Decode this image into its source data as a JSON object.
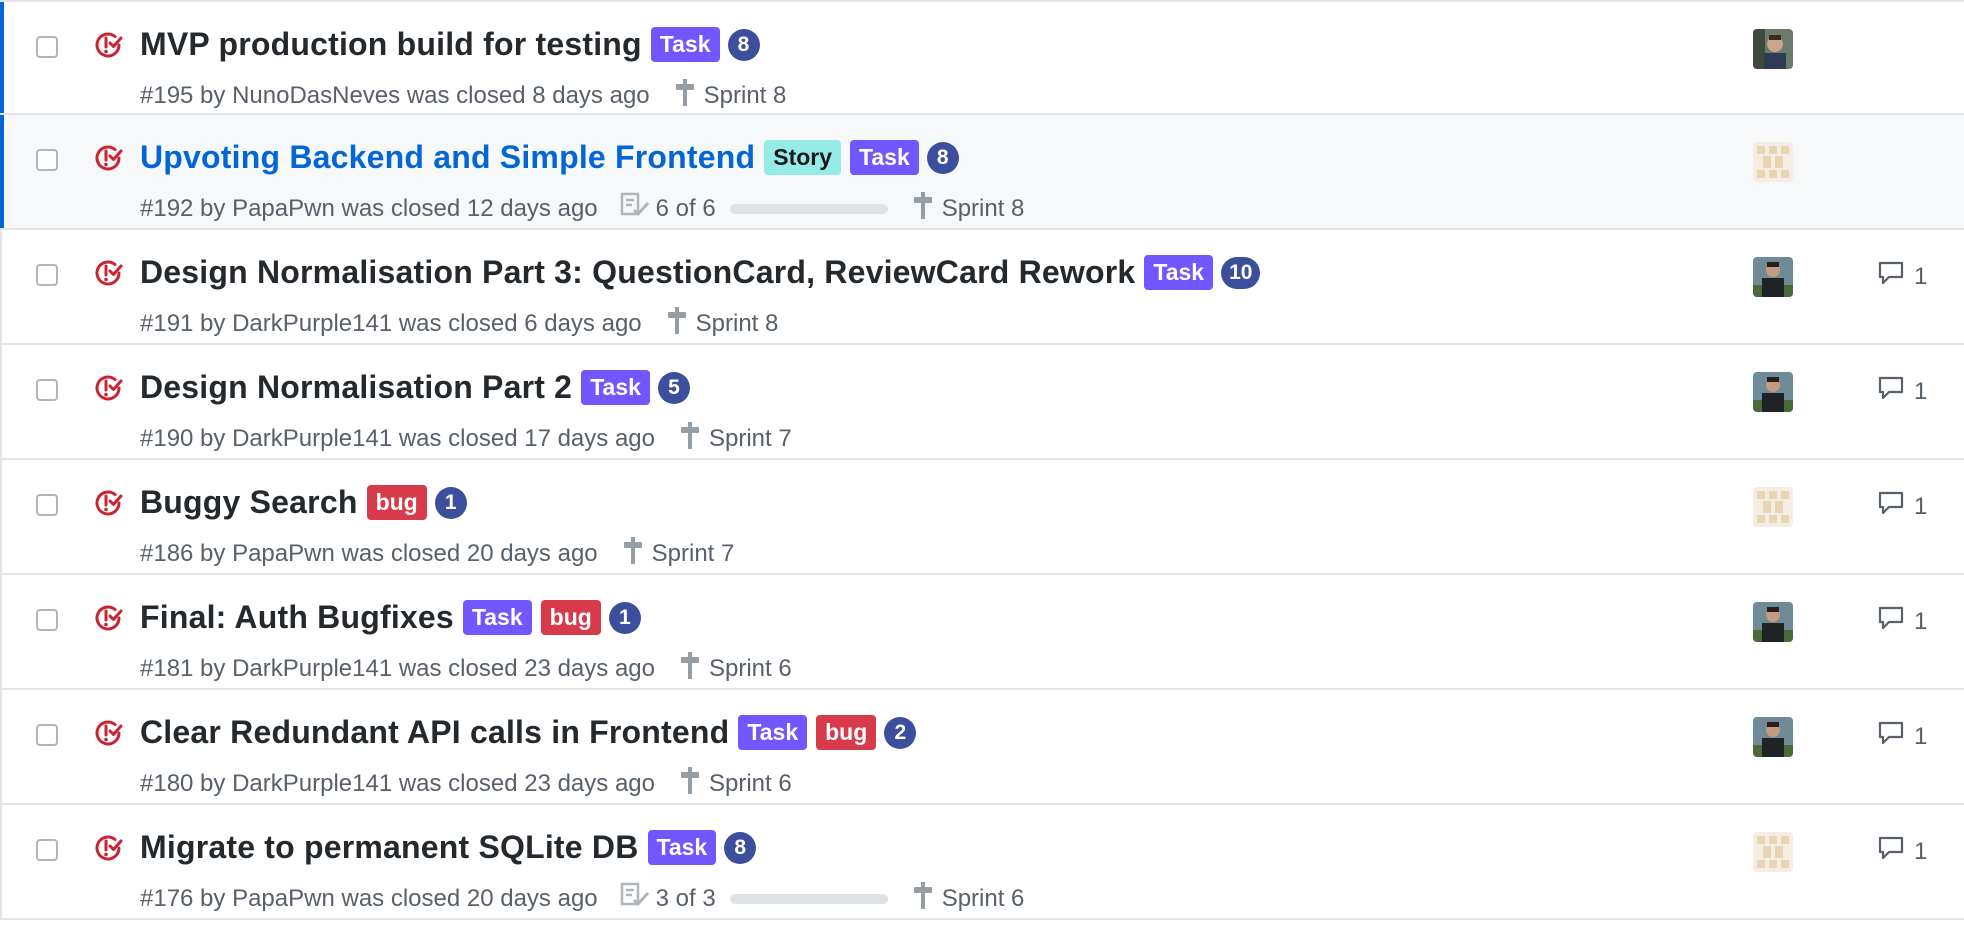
{
  "rows": [
    {
      "title": "MVP production build for testing",
      "labels": [
        {
          "text": "Task",
          "kind": "task"
        }
      ],
      "count": "8",
      "meta": "#195 by NunoDasNeves was closed 8 days ago",
      "tasks": null,
      "milestone": "Sprint 8",
      "avatar": "photo",
      "comments": null,
      "selected": true,
      "hover": false,
      "link": false
    },
    {
      "title": "Upvoting Backend and Simple Frontend",
      "labels": [
        {
          "text": "Story",
          "kind": "story"
        },
        {
          "text": "Task",
          "kind": "task"
        }
      ],
      "count": "8",
      "meta": "#192 by PapaPwn was closed 12 days ago",
      "tasks": {
        "text": "6 of 6",
        "done": 6,
        "total": 6
      },
      "milestone": "Sprint 8",
      "avatar": "identicon",
      "comments": null,
      "selected": true,
      "hover": true,
      "link": true
    },
    {
      "title": "Design Normalisation Part 3: QuestionCard, ReviewCard Rework",
      "labels": [
        {
          "text": "Task",
          "kind": "task"
        }
      ],
      "count": "10",
      "meta": "#191 by DarkPurple141 was closed 6 days ago",
      "tasks": null,
      "milestone": "Sprint 8",
      "avatar": "photo2",
      "comments": "1",
      "selected": false,
      "hover": false,
      "link": false
    },
    {
      "title": "Design Normalisation Part 2",
      "labels": [
        {
          "text": "Task",
          "kind": "task"
        }
      ],
      "count": "5",
      "meta": "#190 by DarkPurple141 was closed 17 days ago",
      "tasks": null,
      "milestone": "Sprint 7",
      "avatar": "photo2",
      "comments": "1",
      "selected": false,
      "hover": false,
      "link": false
    },
    {
      "title": "Buggy Search",
      "labels": [
        {
          "text": "bug",
          "kind": "bug"
        }
      ],
      "count": "1",
      "meta": "#186 by PapaPwn was closed 20 days ago",
      "tasks": null,
      "milestone": "Sprint 7",
      "avatar": "identicon",
      "comments": "1",
      "selected": false,
      "hover": false,
      "link": false
    },
    {
      "title": "Final: Auth Bugfixes",
      "labels": [
        {
          "text": "Task",
          "kind": "task"
        },
        {
          "text": "bug",
          "kind": "bug"
        }
      ],
      "count": "1",
      "meta": "#181 by DarkPurple141 was closed 23 days ago",
      "tasks": null,
      "milestone": "Sprint 6",
      "avatar": "photo2",
      "comments": "1",
      "selected": false,
      "hover": false,
      "link": false
    },
    {
      "title": "Clear Redundant API calls in Frontend",
      "labels": [
        {
          "text": "Task",
          "kind": "task"
        },
        {
          "text": "bug",
          "kind": "bug"
        }
      ],
      "count": "2",
      "meta": "#180 by DarkPurple141 was closed 23 days ago",
      "tasks": null,
      "milestone": "Sprint 6",
      "avatar": "photo2",
      "comments": "1",
      "selected": false,
      "hover": false,
      "link": false
    },
    {
      "title": "Migrate to permanent SQLite DB",
      "labels": [
        {
          "text": "Task",
          "kind": "task"
        }
      ],
      "count": "8",
      "meta": "#176 by PapaPwn was closed 20 days ago",
      "tasks": {
        "text": "3 of 3",
        "done": 3,
        "total": 3
      },
      "milestone": "Sprint 6",
      "avatar": "identicon",
      "comments": "1",
      "selected": false,
      "hover": false,
      "link": false
    }
  ],
  "icons": {
    "closed": "issue-closed-icon",
    "milestone": "milestone-icon",
    "tasks": "task-list-icon",
    "comment": "comment-icon"
  },
  "colors": {
    "closed_icon": "#cb2431",
    "task_label": "#7057ff",
    "bug_label": "#d73a4a",
    "story_label": "#97ebe6",
    "count_badge": "#3c4f9c",
    "link": "#0366d6",
    "selected_bar": "#0366d6"
  }
}
